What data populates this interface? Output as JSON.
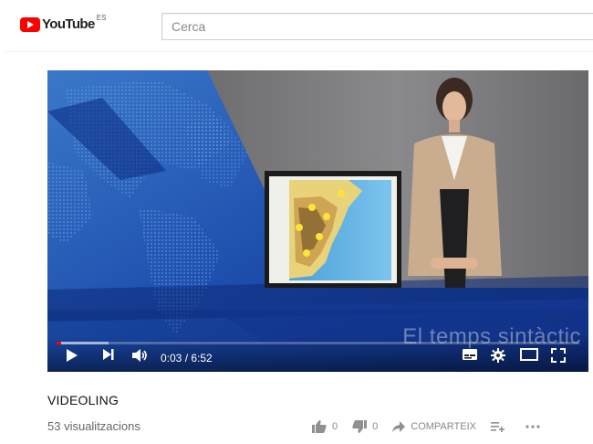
{
  "header": {
    "logo_text": "YouTube",
    "region_code": "ES",
    "search_placeholder": "Cerca"
  },
  "player": {
    "caption_overlay": "El temps sintàctic",
    "time_display": "0:03 / 6:52",
    "progress_fraction": 0.008,
    "buffered_fraction": 0.1
  },
  "video": {
    "title": "VIDEOLING",
    "views": "53 visualitzacions",
    "likes": "0",
    "dislikes": "0",
    "share_label": "COMPARTEIX"
  },
  "colors": {
    "brand_red": "#ff0000",
    "player_blue": "#1a3d96"
  }
}
